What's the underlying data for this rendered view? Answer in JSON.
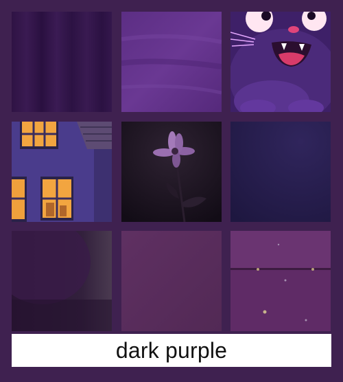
{
  "caption": "dark purple",
  "colors": {
    "background": "#3f2150",
    "caption_bg": "#ffffff",
    "caption_text": "#111111"
  },
  "tiles": [
    {
      "name": "curtain-fabric-tile",
      "colors": [
        "#2c1140",
        "#3a1a52"
      ]
    },
    {
      "name": "painted-texture-tile",
      "colors": [
        "#5a2d80",
        "#6b3a94"
      ]
    },
    {
      "name": "cartoon-cat-tile",
      "colors": [
        "#4b2a7a",
        "#ffd6ea"
      ]
    },
    {
      "name": "house-at-night-tile",
      "colors": [
        "#4b3d8f",
        "#f2a540"
      ]
    },
    {
      "name": "dark-flower-tile",
      "colors": [
        "#1c1520",
        "#9a6fb0"
      ]
    },
    {
      "name": "navy-gradient-tile",
      "colors": [
        "#221a45",
        "#2e2358"
      ]
    },
    {
      "name": "dark-shadow-tile",
      "colors": [
        "#2a1534",
        "#4a2d55"
      ]
    },
    {
      "name": "plain-purple-tile",
      "colors": [
        "#5a2c5e",
        "#6b3a6c"
      ]
    },
    {
      "name": "painted-wood-tile",
      "colors": [
        "#5e2d68",
        "#6e3b76"
      ]
    }
  ]
}
